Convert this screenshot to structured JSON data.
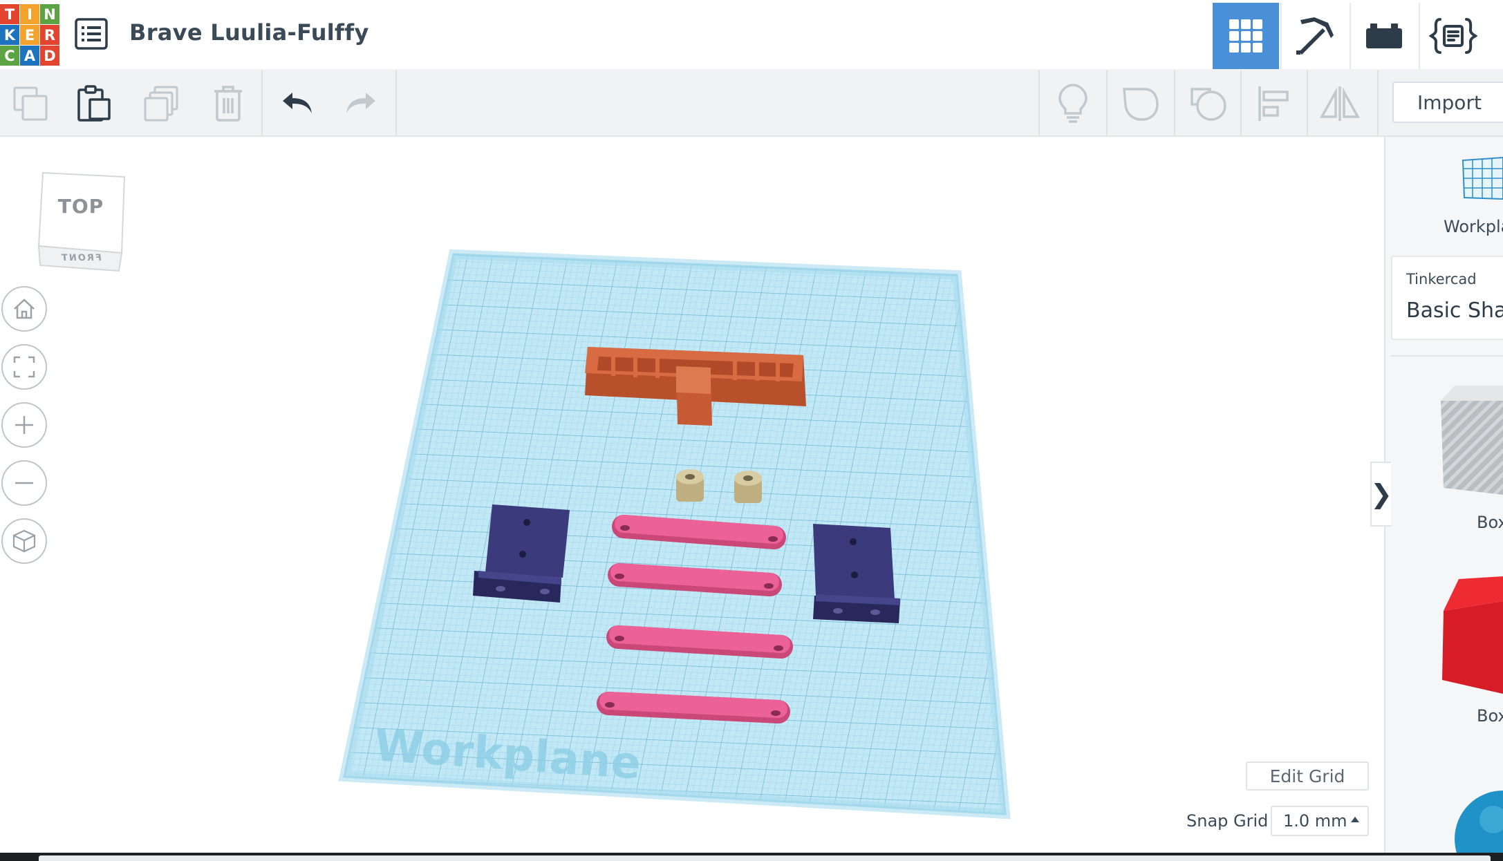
{
  "app": {
    "logo_letters": [
      "T",
      "I",
      "N",
      "K",
      "E",
      "R",
      "C",
      "A",
      "D"
    ],
    "logo_colors": [
      "#e2442f",
      "#f3a22b",
      "#5ca443",
      "#1e73be",
      "#f3a22b",
      "#e2442f",
      "#5ca443",
      "#1e73be",
      "#e2442f"
    ],
    "document_title": "Brave Luulia-Fulffy"
  },
  "header": {
    "menu_icon": "list-icon",
    "modes": [
      {
        "name": "3d-design-view",
        "icon": "grid-icon",
        "active": true
      },
      {
        "name": "blocks-view",
        "icon": "pickaxe-icon",
        "active": false
      },
      {
        "name": "bricks-view",
        "icon": "brick-icon",
        "active": false
      },
      {
        "name": "codeblocks-view",
        "icon": "code-braces-icon",
        "active": false
      }
    ],
    "accent_color": "#4a90d9"
  },
  "toolbar": {
    "left_tools": [
      "copy-icon",
      "paste-icon",
      "duplicate-icon",
      "trash-icon",
      "undo-icon",
      "redo-icon"
    ],
    "right_tools": [
      "lightbulb-icon",
      "solid-shape-icon",
      "hole-shape-icon",
      "align-icon",
      "mirror-icon"
    ],
    "import_label": "Import"
  },
  "viewcube": {
    "top_label": "TOP",
    "front_label": "FRONT"
  },
  "nav_controls": [
    "home-icon",
    "fit-view-icon",
    "zoom-in-icon",
    "zoom-out-icon",
    "perspective-cube-icon"
  ],
  "workplane": {
    "watermark": "Workplane",
    "grid_color": "#9fd6ea",
    "plane_color": "#bfe6f4"
  },
  "scene_objects": [
    {
      "name": "orange-comb-frame",
      "color": "#d4653c"
    },
    {
      "name": "beige-spacer-left",
      "color": "#cdbf96"
    },
    {
      "name": "beige-spacer-right",
      "color": "#cdbf96"
    },
    {
      "name": "navy-bracket-left",
      "color": "#33326e"
    },
    {
      "name": "navy-bracket-right",
      "color": "#33326e"
    },
    {
      "name": "pink-link-1",
      "color": "#e85c8d"
    },
    {
      "name": "pink-link-2",
      "color": "#e85c8d"
    },
    {
      "name": "pink-link-3",
      "color": "#e85c8d"
    },
    {
      "name": "pink-link-4",
      "color": "#e85c8d"
    }
  ],
  "grid_controls": {
    "edit_grid_label": "Edit Grid",
    "snap_grid_label": "Snap Grid",
    "snap_grid_value": "1.0 mm"
  },
  "right_panel": {
    "workplane_tool_label": "Workpla",
    "library_subtitle": "Tinkercad",
    "library_title": "Basic Shap",
    "shapes": [
      {
        "label": "Box",
        "color": "#b3b6ba"
      },
      {
        "label": "Box",
        "color": "#d71f2a"
      }
    ],
    "collapse_glyph": "❯"
  }
}
